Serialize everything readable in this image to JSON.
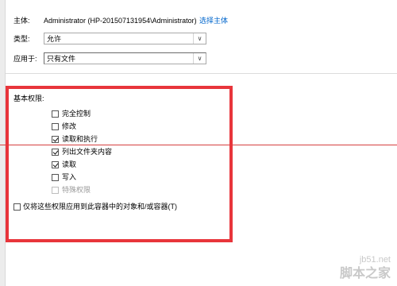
{
  "principal": {
    "label": "主体:",
    "value": "Administrator (HP-201507131954\\Administrator)",
    "select_link": "选择主体"
  },
  "type": {
    "label": "类型:",
    "value": "允许"
  },
  "applies_to": {
    "label": "应用于:",
    "value": "只有文件"
  },
  "basic_permissions": {
    "heading": "基本权限:",
    "items": [
      {
        "label": "完全控制",
        "checked": false,
        "disabled": false
      },
      {
        "label": "修改",
        "checked": false,
        "disabled": false
      },
      {
        "label": "读取和执行",
        "checked": true,
        "disabled": false
      },
      {
        "label": "列出文件夹内容",
        "checked": true,
        "disabled": false
      },
      {
        "label": "读取",
        "checked": true,
        "disabled": false
      },
      {
        "label": "写入",
        "checked": false,
        "disabled": false
      },
      {
        "label": "特殊权限",
        "checked": false,
        "disabled": true
      }
    ]
  },
  "apply_only_container": {
    "label": "仅将这些权限应用到此容器中的对象和/或容器(T)",
    "checked": false
  },
  "watermark": {
    "site": "jb51.net",
    "brand": "脚本之家"
  },
  "colors": {
    "link": "#0066cc",
    "highlight_box": "#e8353b"
  }
}
